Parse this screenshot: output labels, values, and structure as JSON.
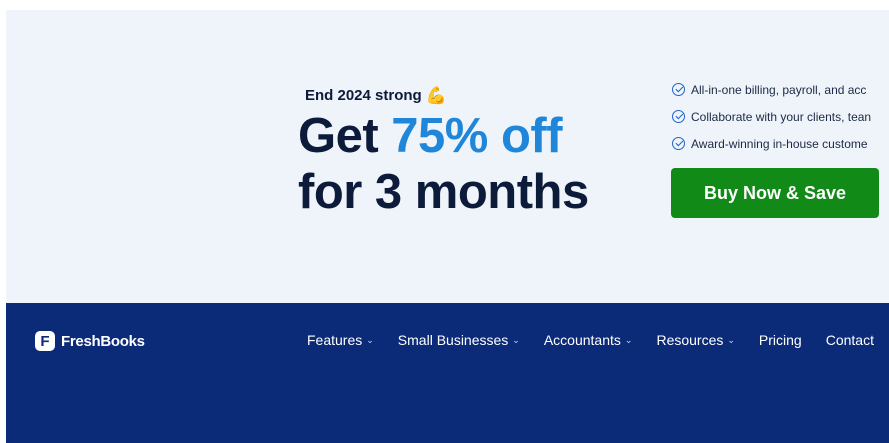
{
  "promo": {
    "tagline": "End 2024 strong",
    "tagline_emoji": "💪",
    "headline_prefix": "Get ",
    "headline_highlight": "75% off",
    "headline_line2": "for 3 months",
    "benefits": [
      "All-in-one billing, payroll, and acc",
      "Collaborate with your clients, tean",
      "Award-winning in-house custome"
    ],
    "cta_label": "Buy Now & Save",
    "colors": {
      "background": "#eef4f9",
      "headline": "#0d1b3a",
      "highlight": "#1f86d9",
      "cta": "#128a17"
    }
  },
  "navbar": {
    "logo_mark": "F",
    "logo_text": "FreshBooks",
    "chevron": "⌄",
    "items": [
      {
        "label": "Features",
        "dropdown": true
      },
      {
        "label": "Small Businesses",
        "dropdown": true
      },
      {
        "label": "Accountants",
        "dropdown": true
      },
      {
        "label": "Resources",
        "dropdown": true
      },
      {
        "label": "Pricing",
        "dropdown": false
      },
      {
        "label": "Contact",
        "dropdown": false
      }
    ],
    "colors": {
      "background": "#0b2a78"
    }
  }
}
